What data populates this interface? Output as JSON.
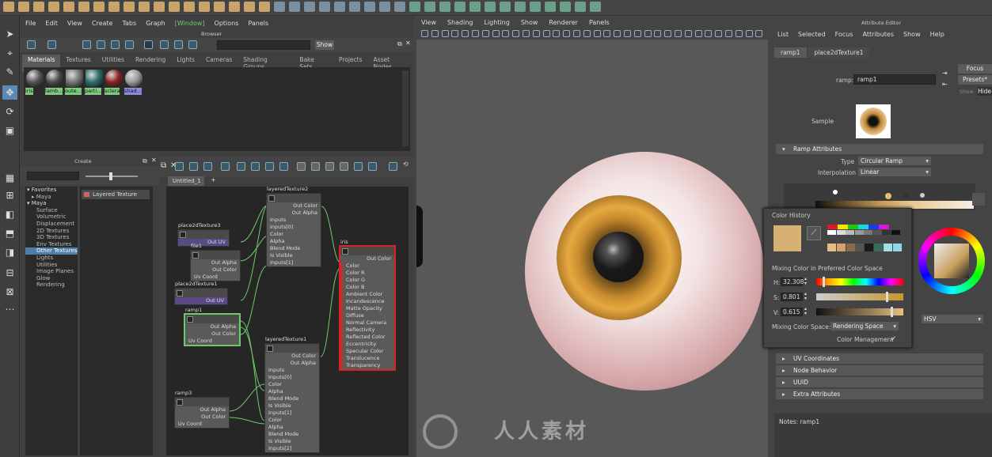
{
  "main_menu": [
    "File",
    "Edit",
    "View",
    "Create",
    "Tabs",
    "Graph",
    "Window",
    "Options",
    "Panels"
  ],
  "active_menu": "Window",
  "browser_title": "Browser",
  "show_button": "Show",
  "browser_tabs": [
    "Materials",
    "Textures",
    "Utilities",
    "Rendering",
    "Lights",
    "Cameras",
    "Shading Groups",
    "Bake Sets",
    "Projects",
    "Asset Nodes"
  ],
  "active_browser_tab": "Materials",
  "materials": [
    {
      "label": "iris",
      "color": "#555"
    },
    {
      "label": "lamb...",
      "color": "#4a4a4a"
    },
    {
      "label": "oute...",
      "color": "#777"
    },
    {
      "label": "parti...",
      "color": "#2e6e6e"
    },
    {
      "label": "sclera",
      "color": "#8a2222"
    },
    {
      "label": "shad...",
      "color": "#999"
    }
  ],
  "create_title": "Create",
  "tree": {
    "items": [
      {
        "text": "Favorites",
        "kind": "h"
      },
      {
        "text": "Maya",
        "kind": "sub"
      },
      {
        "text": "Maya",
        "kind": "h"
      },
      {
        "text": "Surface",
        "kind": "i"
      },
      {
        "text": "Volumetric",
        "kind": "i"
      },
      {
        "text": "Displacement",
        "kind": "i"
      },
      {
        "text": "2D Textures",
        "kind": "i"
      },
      {
        "text": "3D Textures",
        "kind": "i"
      },
      {
        "text": "Env Textures",
        "kind": "i"
      },
      {
        "text": "Other Textures",
        "kind": "sel"
      },
      {
        "text": "Lights",
        "kind": "i"
      },
      {
        "text": "Utilities",
        "kind": "i"
      },
      {
        "text": "Image Planes",
        "kind": "i"
      },
      {
        "text": "Glow",
        "kind": "i"
      },
      {
        "text": "Rendering",
        "kind": "i"
      }
    ]
  },
  "node_list_item": "Layered Texture",
  "graph_tab": "Untitled_1",
  "graph_tab_add": "+",
  "nodes": {
    "place2dTexture3": {
      "title": "place2dTexture3",
      "rows": [
        "Out UV"
      ]
    },
    "file1": {
      "title": "file1",
      "rows": [
        "Out Alpha",
        "Out Color",
        "Uv Coord"
      ]
    },
    "place2dTexture1": {
      "title": "place2dTexture1",
      "rows": [
        "Out UV"
      ]
    },
    "ramp1": {
      "title": "ramp1",
      "rows": [
        "Out Alpha",
        "Out Color",
        "Uv Coord"
      ]
    },
    "ramp3": {
      "title": "ramp3",
      "rows": [
        "Out Alpha",
        "Out Color",
        "Uv Coord"
      ]
    },
    "layeredTexture2": {
      "title": "layeredTexture2",
      "rows": [
        "Out Color",
        "Out Alpha",
        "Inputs",
        "Inputs[0]",
        "Color",
        "Alpha",
        "Blend Mode",
        "Is Visible",
        "Inputs[1]"
      ]
    },
    "layeredTexture1": {
      "title": "layeredTexture1",
      "rows": [
        "Out Color",
        "Out Alpha",
        "Inputs",
        "Inputs[0]",
        "Color",
        "Alpha",
        "Blend Mode",
        "Is Visible",
        "Inputs[1]",
        "Color",
        "Alpha",
        "Blend Mode",
        "Is Visible",
        "Inputs[2]"
      ]
    },
    "iris": {
      "title": "iris",
      "rows": [
        "Out Color",
        "Color",
        "Color R",
        "Color G",
        "Color B",
        "Ambient Color",
        "Incandescence",
        "Matte Opacity",
        "Diffuse",
        "Normal Camera",
        "Reflectivity",
        "Reflected Color",
        "Eccentricity",
        "Specular Color",
        "Translucence",
        "Transparency"
      ]
    }
  },
  "viewport_menu": [
    "View",
    "Shading",
    "Lighting",
    "Show",
    "Renderer",
    "Panels"
  ],
  "attr": {
    "title": "Attribute Editor",
    "menu": [
      "List",
      "Selected",
      "Focus",
      "Attributes",
      "Show",
      "Help"
    ],
    "tabs": [
      "ramp1",
      "place2dTexture1"
    ],
    "ramp_label": "ramp:",
    "ramp_value": "ramp1",
    "focus": "Focus",
    "presets": "Presets*",
    "show": "Show",
    "hide": "Hide",
    "sample_label": "Sample",
    "section_ramp": "Ramp Attributes",
    "type_label": "Type",
    "type_value": "Circular Ramp",
    "interp_label": "Interpolation",
    "interp_value": "Linear",
    "sections": [
      "UV Coordinates",
      "Node Behavior",
      "UUID",
      "Extra Attributes"
    ],
    "notes": "Notes:  ramp1",
    "hsv": "HSV"
  },
  "color_popup": {
    "history_label": "Color History",
    "mixing_label": "Mixing Color in Preferred Color Space",
    "h_label": "H:",
    "h_value": "32.308",
    "s_label": "S:",
    "s_value": "0.801",
    "v_label": "V:",
    "v_value": "0.615",
    "space_label": "Mixing Color Space:",
    "space_value": "Rendering Space",
    "mgmt_label": "Color Management",
    "mgmt_check": "✓",
    "swatches": [
      "#e0162a",
      "#f0e800",
      "#23c414",
      "#1ad6d6",
      "#1a3be6",
      "#d21ad6",
      "#ffffff",
      "#dddddd",
      "#bbbbbb",
      "#999999",
      "#777777",
      "#555555",
      "#333333",
      "#111111",
      "#e0c080",
      "#d8a070",
      "#8a6a4a",
      "#555",
      "#1a1a1a",
      "#3a6a5a",
      "#a0e0e0",
      "#8fd8e8"
    ],
    "current": "#d7b074"
  },
  "watermark": "人人素材",
  "colors": {
    "accent": "#7fc97f",
    "selection": "#4e7ea8",
    "node_selected": "#e02020",
    "wire": "#6ec96e"
  }
}
